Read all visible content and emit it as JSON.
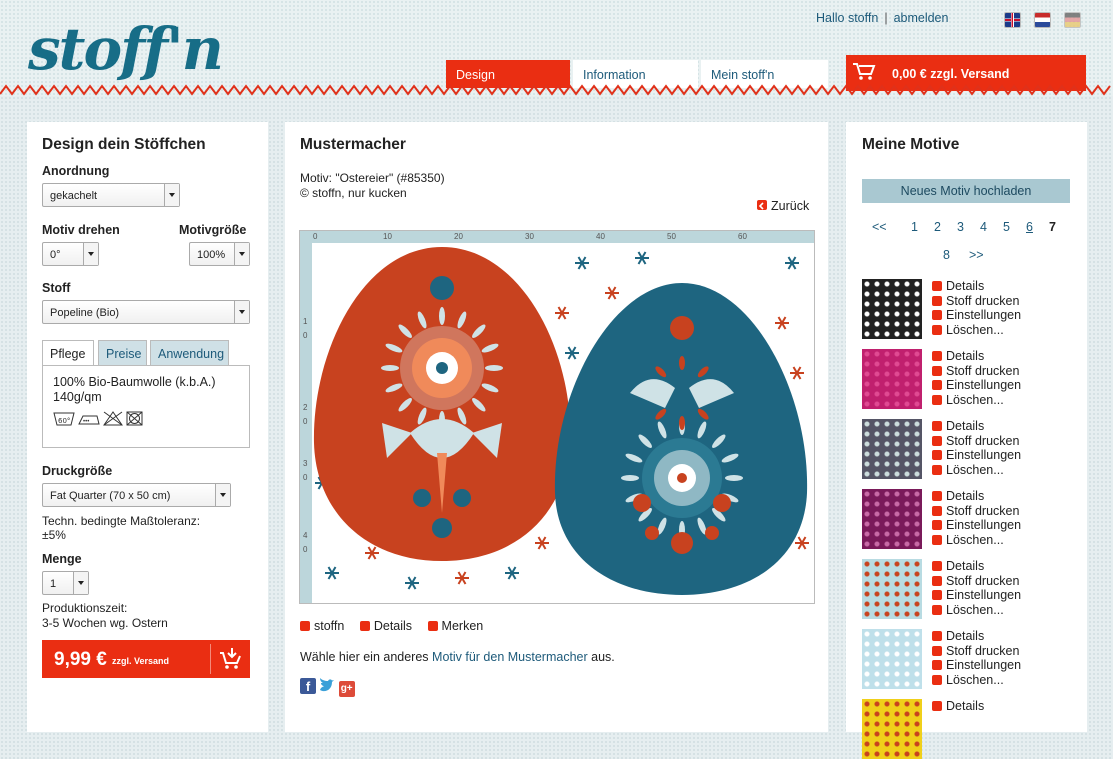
{
  "header": {
    "logo": "stoff'n",
    "greeting": "Hallo stoffn",
    "separator": "|",
    "logout": "abmelden",
    "nav": [
      "Design",
      "Information",
      "Mein stoff'n"
    ],
    "cart_label": "0,00 € zzgl. Versand",
    "languages": [
      "english",
      "nederlands",
      "deutsch"
    ]
  },
  "left": {
    "title": "Design dein Stöffchen",
    "anordnung_label": "Anordnung",
    "anordnung_value": "gekachelt",
    "rotate_label": "Motiv drehen",
    "rotate_value": "0°",
    "size_label": "Motivgröße",
    "size_value": "100%",
    "fabric_label": "Stoff",
    "fabric_value": "Popeline (Bio)",
    "tabs": [
      "Pflege",
      "Preise",
      "Anwendung"
    ],
    "fabric_desc": "100% Bio-Baumwolle (k.b.A.)",
    "fabric_weight": "140g/qm",
    "care_symbols": "⑥⊡⊠⊠",
    "print_size_label": "Druckgröße",
    "print_size_value": "Fat Quarter (70 x 50 cm)",
    "tolerance_text": "Techn. bedingte Maßtoleranz:",
    "tolerance_value": "±5%",
    "quantity_label": "Menge",
    "quantity_value": "1",
    "production_label": "Produktionszeit:",
    "production_value": "3-5 Wochen wg. Ostern",
    "buy_price": "9,99 €",
    "buy_shipping": "zzgl. Versand"
  },
  "middle": {
    "title": "Mustermacher",
    "motif_line": "Motiv: \"Ostereier\" (#85350)",
    "copyright_line": "© stoffn, nur kucken",
    "back_link": "Zurück",
    "ruler_top": [
      "0",
      "10",
      "20",
      "30",
      "40",
      "50",
      "60"
    ],
    "ruler_left": [
      "1",
      "0",
      "2",
      "0",
      "3",
      "0",
      "4",
      "0"
    ],
    "actions": [
      "stoffn",
      "Details",
      "Merken"
    ],
    "choose_text_before": "Wähle hier ein anderes ",
    "choose_link": "Motiv für den Mustermacher",
    "choose_text_after": " aus.",
    "social_g": "g+"
  },
  "right": {
    "title": "Meine Motive",
    "upload_button": "Neues Motiv hochladen",
    "pager_prev": "<<",
    "pages": [
      "1",
      "2",
      "3",
      "4",
      "5",
      "6",
      "7",
      "8"
    ],
    "pager_next": ">>",
    "current_page": "7",
    "motif_actions": [
      "Details",
      "Stoff drucken",
      "Einstellungen",
      "Löschen..."
    ],
    "colors": {
      "accent": "#ea2e12",
      "teal": "#176d87"
    }
  }
}
